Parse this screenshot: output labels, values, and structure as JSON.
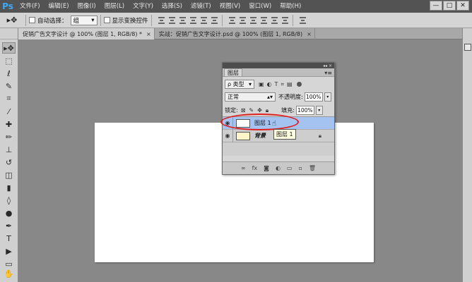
{
  "app": {
    "logo": "Ps"
  },
  "menu": [
    "文件(F)",
    "编辑(E)",
    "图像(I)",
    "图层(L)",
    "文字(Y)",
    "选择(S)",
    "滤镜(T)",
    "视图(V)",
    "窗口(W)",
    "帮助(H)"
  ],
  "window_controls": {
    "minimize": "—",
    "restore": "□",
    "close": "✕"
  },
  "options": {
    "auto_select_label": "自动选择：",
    "auto_select_value": "组",
    "show_transform_label": "显示变换控件"
  },
  "tabs": [
    {
      "label": "促销广告文字设计 @ 100% (图层 1, RGB/8) *",
      "close": "×",
      "active": true
    },
    {
      "label": "实战：促销广告文字设计.psd @ 100% (图层 1, RGB/8)",
      "close": "×",
      "active": false
    }
  ],
  "layers_panel": {
    "title": "图层",
    "menu_icon": "▾≡",
    "collapse": "◂◂ ×",
    "filter_kind": "ρ 类型",
    "blend_mode": "正常",
    "opacity_label": "不透明度:",
    "opacity_value": "100%",
    "lock_label": "锁定:",
    "fill_label": "填充:",
    "fill_value": "100%",
    "layers": [
      {
        "name": "图层 1",
        "selected": true
      },
      {
        "name": "背景",
        "selected": false
      }
    ],
    "tooltip": "图层 1"
  },
  "colors": {
    "menubar_bg": "#535353",
    "workspace_bg": "#888888",
    "selected_layer": "#a4c3f0",
    "highlight_oval": "#e02020",
    "tooltip_bg": "#ffffe0"
  }
}
